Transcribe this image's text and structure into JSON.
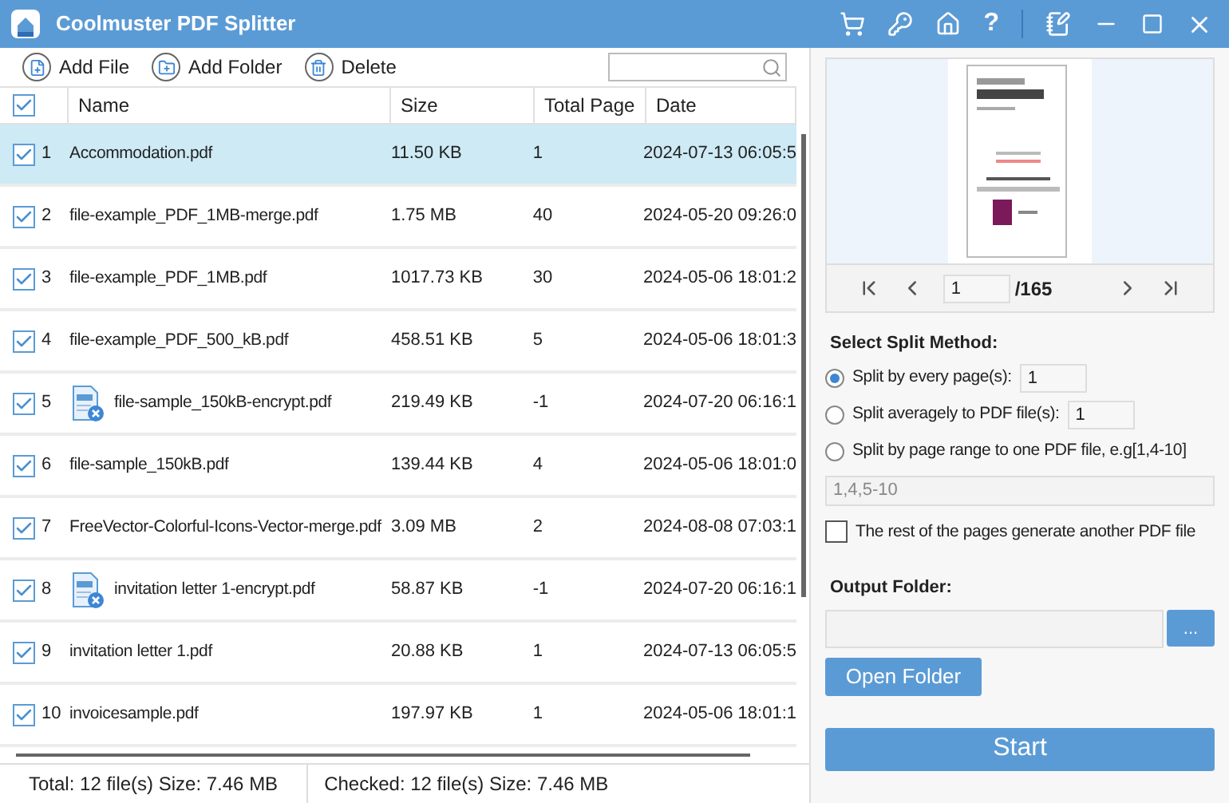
{
  "window": {
    "title": "Coolmuster PDF Splitter",
    "help_glyph": "?"
  },
  "toolbar": {
    "buttons": [
      {
        "kind": "file",
        "label": "Add File"
      },
      {
        "kind": "folder",
        "label": "Add Folder"
      },
      {
        "kind": "delete",
        "label": "Delete"
      }
    ]
  },
  "table": {
    "all_checked": true,
    "columns": [
      "Name",
      "Size",
      "Total Page",
      "Date"
    ],
    "rows": [
      {
        "number": "1",
        "name": "Accommodation.pdf",
        "size": "11.50 KB",
        "pages": "1",
        "date": "2024-07-13 06:05:5",
        "checked": true,
        "selected": true,
        "encrypted": false
      },
      {
        "number": "2",
        "name": "file-example_PDF_1MB-merge.pdf",
        "size": "1.75 MB",
        "pages": "40",
        "date": "2024-05-20 09:26:0",
        "checked": true,
        "selected": false,
        "encrypted": false
      },
      {
        "number": "3",
        "name": "file-example_PDF_1MB.pdf",
        "size": "1017.73 KB",
        "pages": "30",
        "date": "2024-05-06 18:01:2",
        "checked": true,
        "selected": false,
        "encrypted": false
      },
      {
        "number": "4",
        "name": "file-example_PDF_500_kB.pdf",
        "size": "458.51 KB",
        "pages": "5",
        "date": "2024-05-06 18:01:3",
        "checked": true,
        "selected": false,
        "encrypted": false
      },
      {
        "number": "5",
        "name": "file-sample_150kB-encrypt.pdf",
        "size": "219.49 KB",
        "pages": "-1",
        "date": "2024-07-20 06:16:1",
        "checked": true,
        "selected": false,
        "encrypted": true
      },
      {
        "number": "6",
        "name": "file-sample_150kB.pdf",
        "size": "139.44 KB",
        "pages": "4",
        "date": "2024-05-06 18:01:0",
        "checked": true,
        "selected": false,
        "encrypted": false
      },
      {
        "number": "7",
        "name": "FreeVector-Colorful-Icons-Vector-merge.pdf",
        "size": "3.09 MB",
        "pages": "2",
        "date": "2024-08-08 07:03:1",
        "checked": true,
        "selected": false,
        "encrypted": false
      },
      {
        "number": "8",
        "name": "invitation letter 1-encrypt.pdf",
        "size": "58.87 KB",
        "pages": "-1",
        "date": "2024-07-20 06:16:1",
        "checked": true,
        "selected": false,
        "encrypted": true
      },
      {
        "number": "9",
        "name": "invitation letter 1.pdf",
        "size": "20.88 KB",
        "pages": "1",
        "date": "2024-07-13 06:05:5",
        "checked": true,
        "selected": false,
        "encrypted": false
      },
      {
        "number": "10",
        "name": "invoicesample.pdf",
        "size": "197.97 KB",
        "pages": "1",
        "date": "2024-05-06 18:01:1",
        "checked": true,
        "selected": false,
        "encrypted": false
      }
    ]
  },
  "status_bar": {
    "total": "Total: 12 file(s) Size: 7.46 MB",
    "checked": "Checked: 12 file(s) Size: 7.46 MB"
  },
  "preview": {
    "page": "1",
    "page_count": "/165"
  },
  "split": {
    "heading": "Select Split Method:",
    "options": [
      {
        "label": "Split by every page(s):",
        "value": "1",
        "selected": true
      },
      {
        "label": "Split averagely to PDF file(s):",
        "value": "1",
        "selected": false
      },
      {
        "label": "Split by page range to one PDF file, e.g[1,4-10]",
        "selected": false
      }
    ],
    "range": {
      "placeholder": "1,4,5-10"
    },
    "rest": {
      "label": "The rest of the pages generate another PDF file",
      "checked": false
    }
  },
  "output": {
    "heading": "Output Folder:",
    "browse": "...",
    "open": "Open Folder"
  },
  "start": "Start"
}
